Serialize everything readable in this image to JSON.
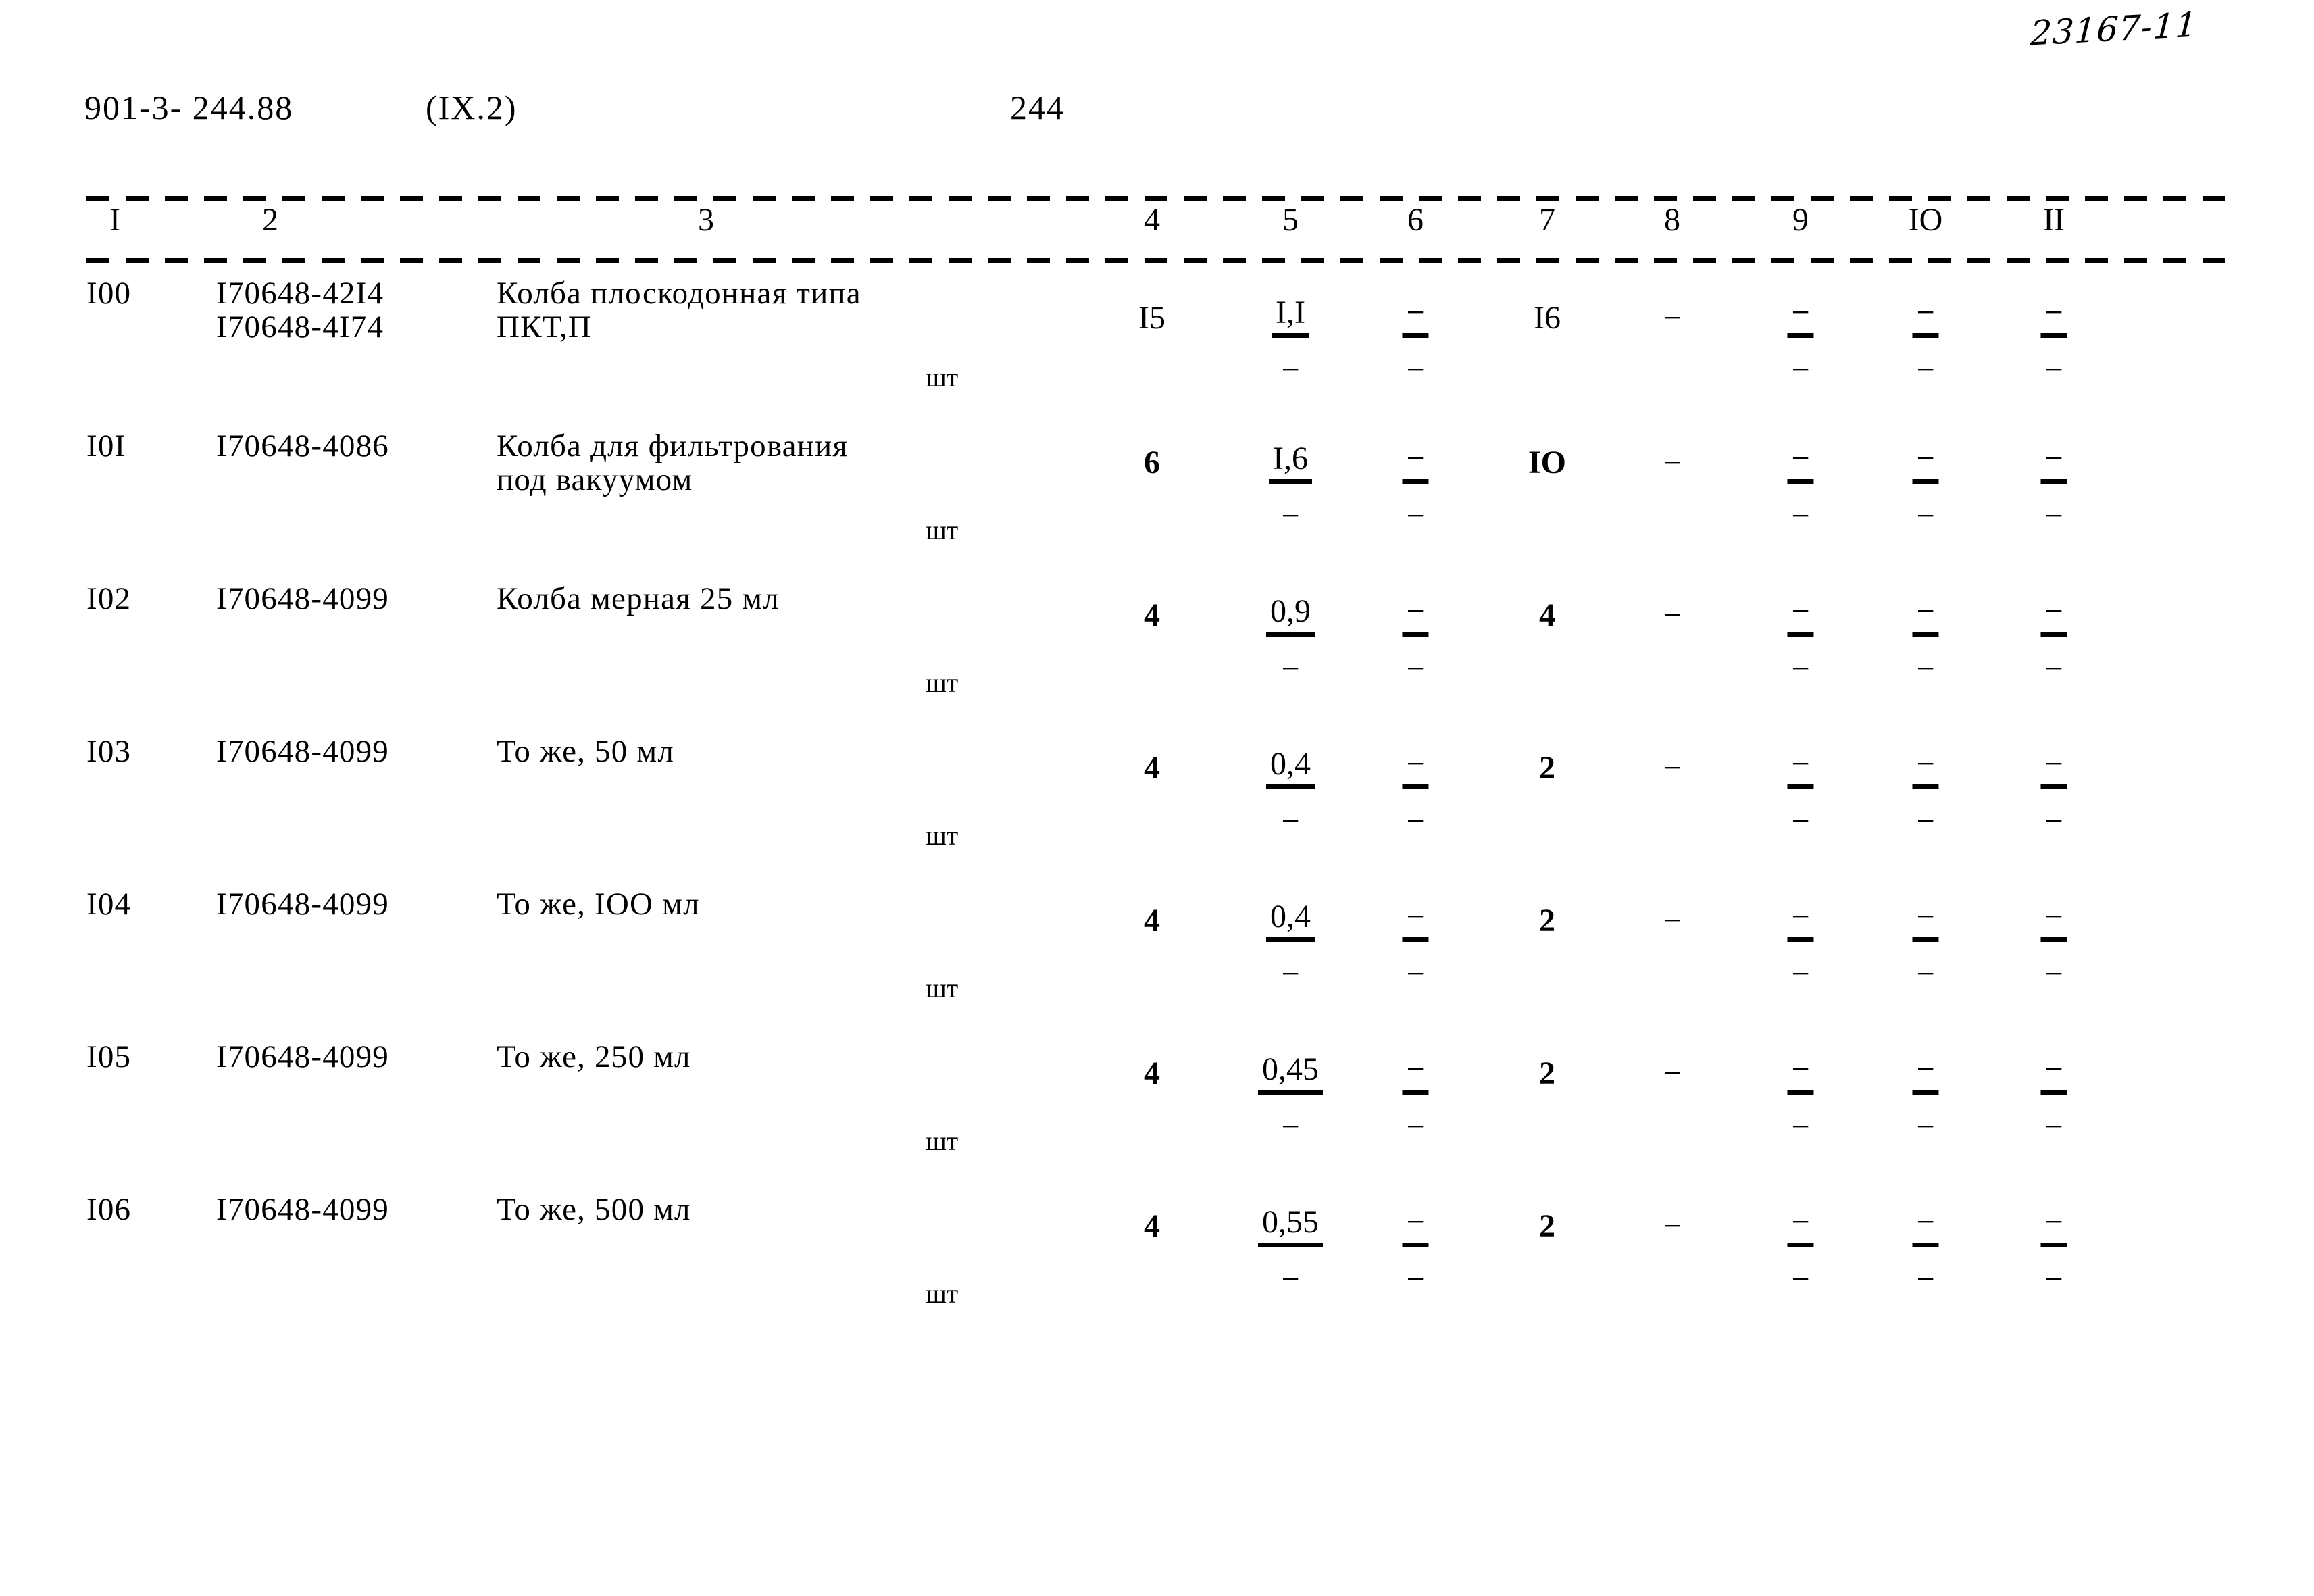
{
  "archive_note": "23167-11",
  "header": {
    "doc_code": "901-3- 244.88",
    "section": "(IX.2)",
    "page_number": "244"
  },
  "table": {
    "column_numbers": [
      "I",
      "2",
      "3",
      "4",
      "5",
      "6",
      "7",
      "8",
      "9",
      "IO",
      "II"
    ],
    "unit_label": "шт",
    "dash": "−",
    "rows": [
      {
        "pos": "I00",
        "code_line1": "I70648-42I4",
        "code_line2": "I70648-4I74",
        "name_line1": "Колба плоскодонная типа",
        "name_line2": "ПКТ,П",
        "unit": "шт",
        "col4": "I5",
        "col5_top": "I,I",
        "col5_bot": "−",
        "col6_top": "−",
        "col6_bot": "−",
        "col7": "I6",
        "col8": "−",
        "col9_top": "−",
        "col9_bot": "−",
        "col10_top": "−",
        "col10_bot": "−",
        "col11_top": "−",
        "col11_bot": "−"
      },
      {
        "pos": "I0I",
        "code_line1": "I70648-4086",
        "code_line2": "",
        "name_line1": "Колба для фильтрования",
        "name_line2": "под вакуумом",
        "unit": "шт",
        "col4": "6",
        "col5_top": "I,6",
        "col5_bot": "−",
        "col6_top": "−",
        "col6_bot": "−",
        "col7": "IO",
        "col8": "−",
        "col9_top": "−",
        "col9_bot": "−",
        "col10_top": "−",
        "col10_bot": "−",
        "col11_top": "−",
        "col11_bot": "−"
      },
      {
        "pos": "I02",
        "code_line1": "I70648-4099",
        "code_line2": "",
        "name_line1": "Колба мерная 25 мл",
        "name_line2": "",
        "unit": "шт",
        "col4": "4",
        "col5_top": "0,9",
        "col5_bot": "−",
        "col6_top": "−",
        "col6_bot": "−",
        "col7": "4",
        "col8": "−",
        "col9_top": "−",
        "col9_bot": "−",
        "col10_top": "−",
        "col10_bot": "−",
        "col11_top": "−",
        "col11_bot": "−"
      },
      {
        "pos": "I03",
        "code_line1": "I70648-4099",
        "code_line2": "",
        "name_line1": "То же, 50 мл",
        "name_line2": "",
        "unit": "шт",
        "col4": "4",
        "col5_top": "0,4",
        "col5_bot": "−",
        "col6_top": "−",
        "col6_bot": "−",
        "col7": "2",
        "col8": "−",
        "col9_top": "−",
        "col9_bot": "−",
        "col10_top": "−",
        "col10_bot": "−",
        "col11_top": "−",
        "col11_bot": "−"
      },
      {
        "pos": "I04",
        "code_line1": "I70648-4099",
        "code_line2": "",
        "name_line1": "То же, IOO мл",
        "name_line2": "",
        "unit": "шт",
        "col4": "4",
        "col5_top": "0,4",
        "col5_bot": "−",
        "col6_top": "−",
        "col6_bot": "−",
        "col7": "2",
        "col8": "−",
        "col9_top": "−",
        "col9_bot": "−",
        "col10_top": "−",
        "col10_bot": "−",
        "col11_top": "−",
        "col11_bot": "−"
      },
      {
        "pos": "I05",
        "code_line1": "I70648-4099",
        "code_line2": "",
        "name_line1": "То же, 250 мл",
        "name_line2": "",
        "unit": "шт",
        "col4": "4",
        "col5_top": "0,45",
        "col5_bot": "−",
        "col6_top": "−",
        "col6_bot": "−",
        "col7": "2",
        "col8": "−",
        "col9_top": "−",
        "col9_bot": "−",
        "col10_top": "−",
        "col10_bot": "−",
        "col11_top": "−",
        "col11_bot": "−"
      },
      {
        "pos": "I06",
        "code_line1": "I70648-4099",
        "code_line2": "",
        "name_line1": "То же, 500 мл",
        "name_line2": "",
        "unit": "шт",
        "col4": "4",
        "col5_top": "0,55",
        "col5_bot": "−",
        "col6_top": "−",
        "col6_bot": "−",
        "col7": "2",
        "col8": "−",
        "col9_top": "−",
        "col9_bot": "−",
        "col10_top": "−",
        "col10_bot": "−",
        "col11_top": "−",
        "col11_bot": "−"
      }
    ]
  }
}
